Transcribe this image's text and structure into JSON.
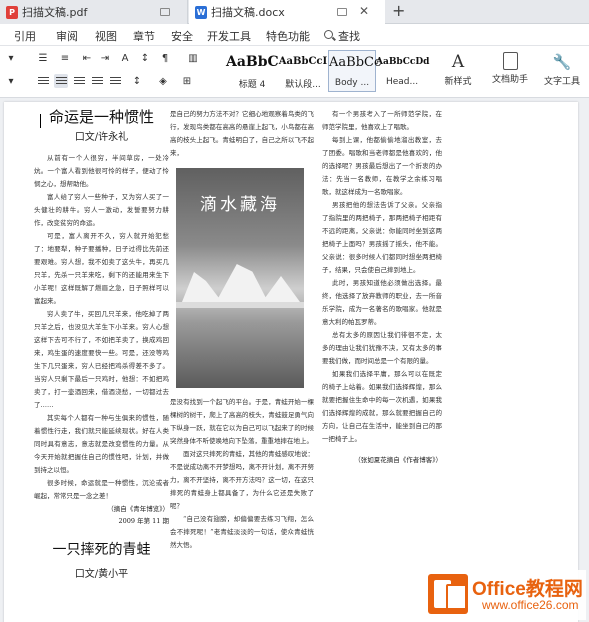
{
  "tabs": [
    {
      "label": "扫描文稿.pdf",
      "file_type": "pdf"
    },
    {
      "label": "扫描文稿.docx",
      "file_type": "docx"
    }
  ],
  "menu": [
    "引用",
    "审阅",
    "视图",
    "章节",
    "安全",
    "开发工具",
    "特色功能"
  ],
  "menu_search": "查找",
  "styles": [
    {
      "preview": "AaBbC",
      "name": "标题 4"
    },
    {
      "preview": "AaBbCcI",
      "name": "默认段..."
    },
    {
      "preview": "AaBbCc",
      "name": "Body ..."
    },
    {
      "preview": "AaBbCcDd",
      "name": "Head..."
    }
  ],
  "ribbon_buttons": {
    "new_style": "新样式",
    "doc_helper": "文档助手",
    "text_tools": "文字工具"
  },
  "colors": {
    "accent": "#2b6fd6",
    "pdf_red": "#e0403a",
    "logo_orange": "#e8620f"
  },
  "document": {
    "title1": "命运是一种惯性",
    "author1": "口文/许永礼",
    "col1_paragraphs": [
      "从前有一个人很穷，半间草房，一处冷炕。一个富人看到他很可怜的样子，便动了怜悯之心，想帮助他。",
      "富人给了穷人一些种子，又为穷人买了一头健壮的耕牛。穷人一激动，发誓要努力耕作，改变贫穷的命运。",
      "可是，富人离开不久，穷人就开始犯愁了：地要犁，种子要播种，日子过得比先前还要艰难。穷人想，我不如卖了这头牛，再买几只羊，先杀一只羊来吃，剩下的还能用来生下小羊呢！这样既解了燃眉之急，日子照样可以富起来。",
      "穷人卖了牛，买回几只羊来，他吃掉了两只羊之后，也没见大羊生下小羊来。穷人心想这样下去可不行了，不如把羊卖了，换成鸡回来，鸡生蛋的速度要快一些。可是，还没等鸡生下几只蛋来，穷人已经把鸡杀得差不多了。当穷人只剩下最后一只鸡时，他想：不如把鸡卖了，打一壶酒回来，借酒浇愁，一切都过去了……",
      "其实每个人都有一种与生俱来的惯性，随着惯性行走，我们就只能延续现状。好在人类同时具有意志，意志就是改变惯性的力量。从今天开始就把握住自己的惯性吧，计划，并做到持之以恒。",
      "很多时候，命运就是一种惯性，沉沦或者崛起，常常只是一念之差！"
    ],
    "source1": "（摘自《青年博览》）",
    "date1": "2009 年第 11 期",
    "title2": "一只摔死的青蛙",
    "author2": "口文/黄小平",
    "col2_top": "是自己的努力方法不对？它细心地观察着鸟类的飞行，发现鸟类都在高高的悬崖上起飞，小鸟都在高高的枝头上起飞。青蛙明白了，自己之所以飞不起来，",
    "painting_title": "滴水藏海",
    "col2_bottom": [
      "是没有找到一个起飞的平台。于是，青蛙开始一棵棵树的树干，爬上了高高的枝头，青蛙鼓足勇气向下纵身一跃，就在它以为自己可以飞起来了的时候突然身体不听使唤地向下坠落，重重地摔在地上。",
      "面对这只摔死的青蛙，其他的青蛙感叹地说：不是说成功离不开梦想吗，离不开计划，离不开努力，离不开坚持，离不开方法吗？这一切，在这只摔死的青蛙身上都具备了，为什么它还是失败了呢？",
      "“自己没有翅膀，却偏偏要去练习飞翔，怎么会不摔死呢！”老青蛙淡淡的一句话，使众青蛙恍然大悟。"
    ],
    "col3_paragraphs": [
      "有一个男孩考入了一所师范学院，在师范学院里，他喜欢上了唱歌。",
      "每到上课，他都偷偷地溜出教室，去了团委。唱歌和当老师都是他喜欢的，他的选择呢？男孩最后想出了一个折衷的办法：先当一名教师，在教学之余练习唱歌，就这样成为一名歌唱家。",
      "男孩把他的想法告诉了父亲。父亲指了指院里的两把椅子，那两把椅子相距有不远的距离，父亲说：你能同时坐到这两把椅子上面吗？男孩摇了摇头，他不能。父亲说：很多时候人们都同时想坐两把椅子，结果，只会使自己摔到地上。",
      "此时，男孩知道他必须做出选择。最终，他选择了放弃教师的职业，去一所音乐学院，成为一名著名的歌唱家。他就是意大利的帕瓦罗蒂。",
      "总有太多的原因让我们徘徊不定，太多的理由让我们犹豫不决，又有太多的事要我们做，而时间总是一个有限的量。",
      "如果我们选择平庸，那么可以在既定的椅子上站着。如果我们选择辉煌，那么就要把握住生命中的每一次机遇，如果我们选择辉煌的成就，那么就要把握自己的方向，让自己在生活中，能坐到自己的那一把椅子上。"
    ],
    "credit3": "（张如夏花摘自《作者博客》）"
  },
  "watermark": {
    "brand": "Office教程网",
    "url": "www.office26.com"
  }
}
